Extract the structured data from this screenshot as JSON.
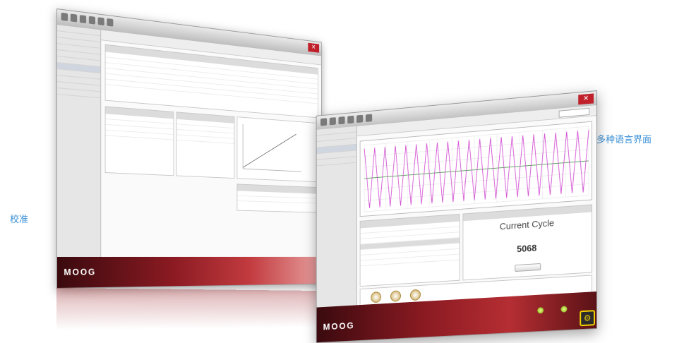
{
  "labels": {
    "left": "校准",
    "right": "多种语言界面"
  },
  "status": {
    "current_cycle_title": "Current Cycle",
    "current_cycle_value": "5068"
  },
  "icons": {
    "close": "close-icon",
    "gear": "gear-icon",
    "led": "status-led-icon"
  },
  "colors": {
    "label": "#3a8fd6",
    "brand_red": "#8b1a22",
    "plot_line": "#d24fd2",
    "plot_grid_accent": "#2c8a2c",
    "led_green": "#7aa800"
  },
  "chart_data": {
    "type": "line",
    "title": "",
    "xlabel": "",
    "ylabel": "",
    "series": [
      {
        "values": [
          0.9,
          -0.9,
          0.9,
          -0.9,
          0.9,
          -0.9,
          0.9,
          -0.9,
          0.9,
          -0.9,
          0.9,
          -0.9,
          0.9,
          -0.9,
          0.9,
          -0.9,
          0.9,
          -0.9,
          0.9,
          -0.9,
          0.9,
          -0.9,
          0.9,
          -0.9,
          0.9,
          -0.9,
          0.9,
          -0.9,
          0.9,
          -0.9,
          0.9,
          -0.9,
          0.9,
          -0.9,
          0.9,
          -0.9,
          0.9,
          -0.9,
          0.9,
          -0.9,
          0.9,
          -0.9,
          0.9
        ]
      }
    ],
    "ylim": [
      -1,
      1
    ],
    "grid": true
  }
}
